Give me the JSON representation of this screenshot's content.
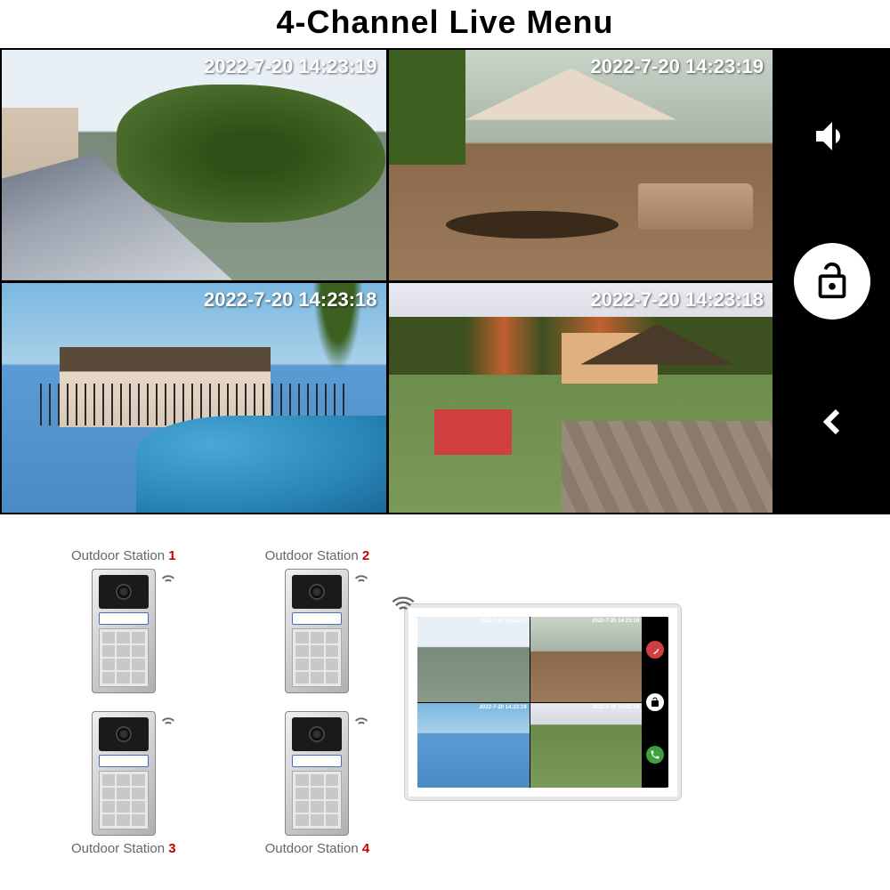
{
  "title": "4-Channel Live Menu",
  "cameras": [
    {
      "timestamp": "2022-7-20 14:23:19"
    },
    {
      "timestamp": "2022-7-20 14:23:19"
    },
    {
      "timestamp": "2022-7-20 14:23:18"
    },
    {
      "timestamp": "2022-7-20 14:23:18"
    }
  ],
  "stations": [
    {
      "label": "Outdoor Station",
      "num": "1"
    },
    {
      "label": "Outdoor Station",
      "num": "2"
    },
    {
      "label": "Outdoor Station",
      "num": "3"
    },
    {
      "label": "Outdoor Station",
      "num": "4"
    }
  ],
  "monitor_mini_ts": "2022-7-20 14:23:19"
}
